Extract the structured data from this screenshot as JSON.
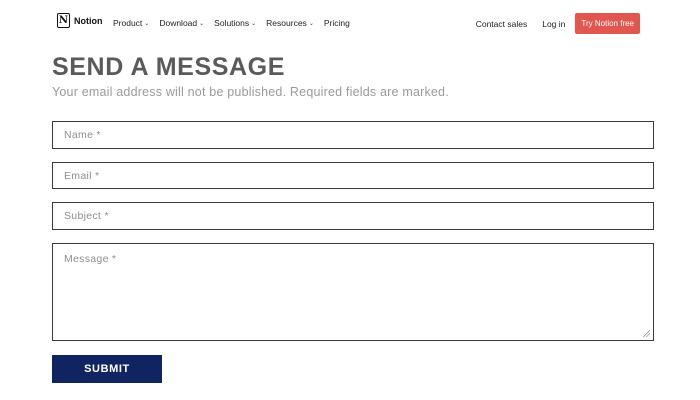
{
  "nav": {
    "logo_mark": "N",
    "logo_text": "Notion",
    "items": [
      {
        "label": "Product",
        "caret": "⌄"
      },
      {
        "label": "Download",
        "caret": "⌄"
      },
      {
        "label": "Solutions",
        "caret": "⌄"
      },
      {
        "label": "Resources",
        "caret": "⌄"
      },
      {
        "label": "Pricing",
        "caret": ""
      }
    ],
    "contact": "Contact sales",
    "login": "Log in",
    "cta": "Try Notion free",
    "cta_color": "#e1574f"
  },
  "form": {
    "title": "SEND A MESSAGE",
    "subtitle": "Your email address will not be published. Required fields are marked.",
    "name_placeholder": "Name *",
    "email_placeholder": "Email *",
    "subject_placeholder": "Subject *",
    "message_placeholder": "Message *",
    "submit_label": "SUBMIT",
    "submit_color": "#0f2460"
  }
}
